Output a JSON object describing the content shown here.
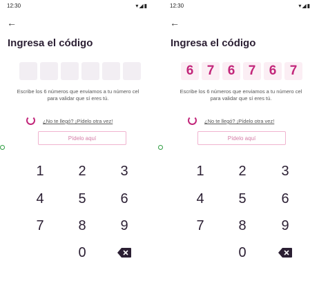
{
  "screens": [
    {
      "status_time": "12:30",
      "status_icons": "▾◢▮",
      "back_glyph": "←",
      "title": "Ingresa el código",
      "code_digits": [
        "",
        "",
        "",
        "",
        "",
        ""
      ],
      "instruction": "Escribe los 6 números que enviamos a tu número cel para validar que sí eres tú.",
      "resend_text": "¿No te llegó? ¡Pídelo otra vez!",
      "ask_button": "Pídelo aquí",
      "keys": [
        "1",
        "2",
        "3",
        "4",
        "5",
        "6",
        "7",
        "8",
        "9",
        "0"
      ]
    },
    {
      "status_time": "12:30",
      "status_icons": "▾◢▮",
      "back_glyph": "←",
      "title": "Ingresa el código",
      "code_digits": [
        "6",
        "7",
        "6",
        "7",
        "6",
        "7"
      ],
      "instruction": "Escribe los 6 números que enviamos a tu número cel para validar que sí eres tú.",
      "resend_text": "¿No te llegó? ¡Pídelo otra vez!",
      "ask_button": "Pídelo aquí",
      "keys": [
        "1",
        "2",
        "3",
        "4",
        "5",
        "6",
        "7",
        "8",
        "9",
        "0"
      ]
    }
  ],
  "icons": {
    "backspace": "backspace-icon",
    "back": "arrow-left-icon",
    "spinner": "loading-spinner-icon"
  },
  "colors": {
    "accent": "#c2267a",
    "box_empty": "#f2eef3",
    "box_filled": "#fbeef4",
    "button_border": "#f0b3cf",
    "text": "#2b1f33"
  }
}
